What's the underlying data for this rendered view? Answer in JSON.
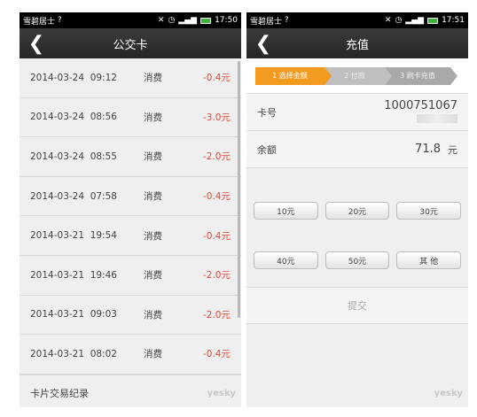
{
  "left": {
    "status": {
      "carrier": "雪碧居士",
      "time": "17:50"
    },
    "title": "公交卡",
    "transactions": [
      {
        "date": "2014-03-24  09:12",
        "type": "消费",
        "amount": "-0.4元"
      },
      {
        "date": "2014-03-24  08:56",
        "type": "消费",
        "amount": "-3.0元"
      },
      {
        "date": "2014-03-24  08:55",
        "type": "消费",
        "amount": "-2.0元"
      },
      {
        "date": "2014-03-24  07:58",
        "type": "消费",
        "amount": "-0.4元"
      },
      {
        "date": "2014-03-21  19:54",
        "type": "消费",
        "amount": "-0.4元"
      },
      {
        "date": "2014-03-21  19:46",
        "type": "消费",
        "amount": "-2.0元"
      },
      {
        "date": "2014-03-21  09:03",
        "type": "消费",
        "amount": "-2.0元"
      },
      {
        "date": "2014-03-21  08:02",
        "type": "消费",
        "amount": "-0.4元"
      }
    ],
    "footer": "卡片交易纪录",
    "watermark": "yesky"
  },
  "right": {
    "status": {
      "carrier": "雪碧居士",
      "time": "17:51"
    },
    "title": "充值",
    "steps": [
      "1 选择金额",
      "2 付款",
      "3 刷卡充值"
    ],
    "card_label": "卡号",
    "card_number": "10007510​67",
    "balance_label": "余额",
    "balance_value": "71.8",
    "balance_unit": "元",
    "amount_options": [
      "10元",
      "20元",
      "30元",
      "40元",
      "50元",
      "其 他"
    ],
    "submit": "提交",
    "watermark": "yesky"
  },
  "colors": {
    "accent": "#f39b1e",
    "negative": "#e04a3a",
    "titlebar": "#2f2f2f"
  }
}
